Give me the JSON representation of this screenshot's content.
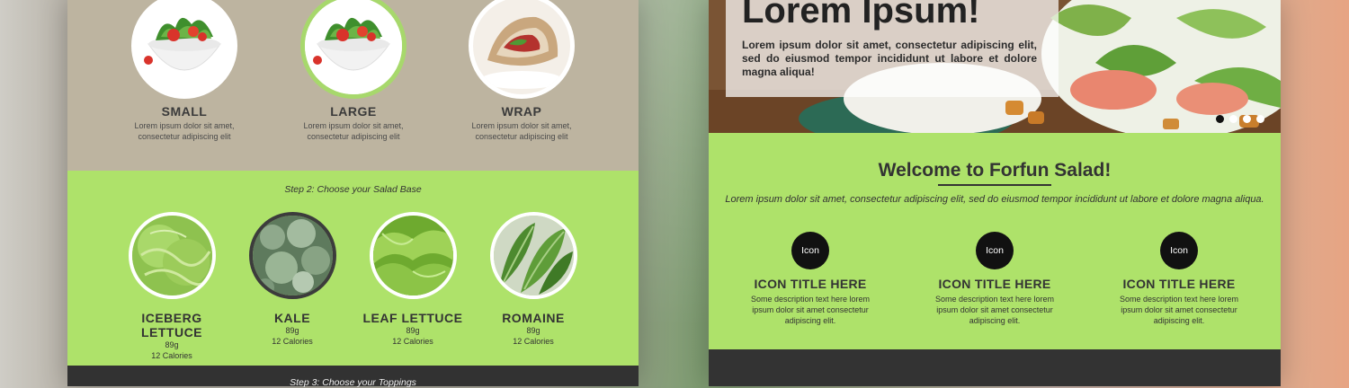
{
  "left": {
    "sizes": [
      {
        "title": "SMALL",
        "desc": "Lorem ipsum dolor sit amet, consectetur adipiscing elit",
        "image": "salad-bowl-small",
        "selected": false
      },
      {
        "title": "LARGE",
        "desc": "Lorem ipsum dolor sit amet, consectetur adipiscing elit",
        "image": "salad-bowl-large",
        "selected": true
      },
      {
        "title": "WRAP",
        "desc": "Lorem ipsum dolor sit amet, consectetur adipiscing elit",
        "image": "salad-wrap",
        "selected": false
      }
    ],
    "step2_label": "Step 2: Choose your Salad Base",
    "bases": [
      {
        "title": "ICEBERG LETTUCE",
        "weight": "89g",
        "calories": "12 Calories",
        "image": "iceberg-lettuce",
        "selected": false
      },
      {
        "title": "KALE",
        "weight": "89g",
        "calories": "12 Calories",
        "image": "kale",
        "selected": true
      },
      {
        "title": "LEAF LETTUCE",
        "weight": "89g",
        "calories": "12 Calories",
        "image": "leaf-lettuce",
        "selected": false
      },
      {
        "title": "ROMAINE",
        "weight": "89g",
        "calories": "12 Calories",
        "image": "romaine",
        "selected": false
      }
    ],
    "step3_label": "Step 3: Choose your Toppings"
  },
  "right": {
    "hero": {
      "title": "Lorem Ipsum!",
      "text": "Lorem ipsum dolor sit amet, consectetur adipiscing elit, sed do eiusmod tempor incididunt ut labore et dolore magna aliqua!",
      "slider_dots": 4,
      "active_dot": 0
    },
    "welcome": {
      "title": "Welcome to Forfun Salad!",
      "text": "Lorem ipsum dolor sit amet, consectetur adipiscing elit, sed do eiusmod tempor incididunt ut labore et dolore magna aliqua."
    },
    "features": [
      {
        "icon_label": "Icon",
        "title": "ICON TITLE HERE",
        "desc": "Some description text here lorem ipsum dolor sit amet consectetur adipiscing elit."
      },
      {
        "icon_label": "Icon",
        "title": "ICON TITLE HERE",
        "desc": "Some description text here lorem ipsum dolor sit amet consectetur adipiscing elit."
      },
      {
        "icon_label": "Icon",
        "title": "ICON TITLE HERE",
        "desc": "Some description text here lorem ipsum dolor sit amet consectetur adipiscing elit."
      }
    ]
  },
  "colors": {
    "accent_green": "#aee26a",
    "tan": "#bdb4a0",
    "dark": "#323232",
    "selected_ring": "#a7d86c"
  }
}
